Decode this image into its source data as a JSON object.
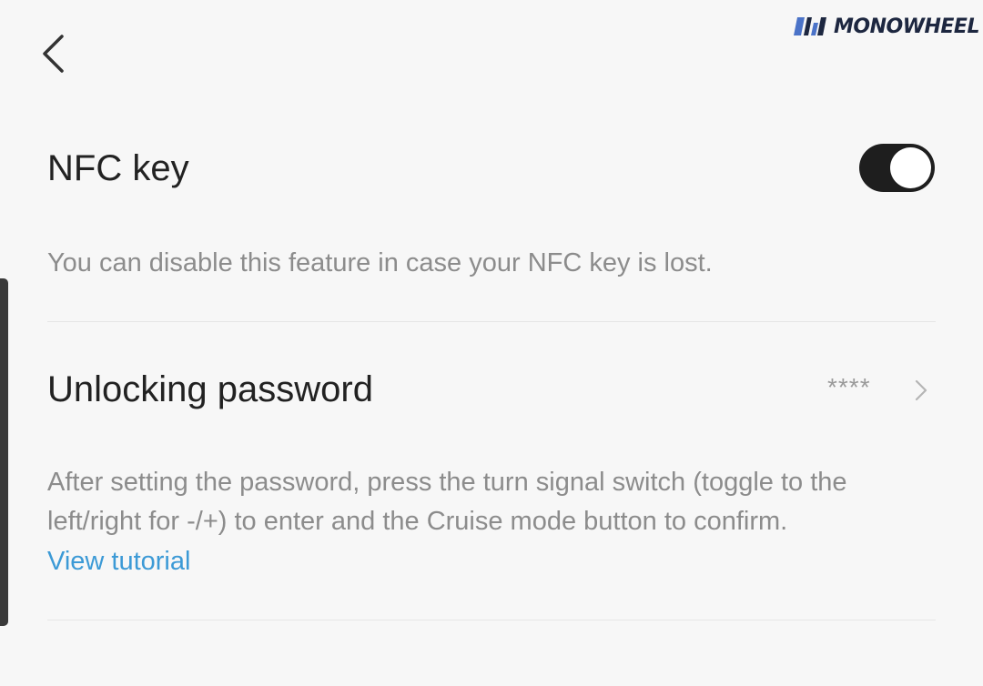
{
  "brand": {
    "logo_text": "MONOWHEEL",
    "logo_color": "#1d2740",
    "mark_color": "#4b73c8"
  },
  "nav": {
    "back_icon": "chevron-left-icon"
  },
  "nfc": {
    "title": "NFC key",
    "enabled": true,
    "description": "You can disable this feature in case your NFC key is lost."
  },
  "password": {
    "title": "Unlocking password",
    "value": "****",
    "chevron_icon": "chevron-right-icon",
    "description": "After setting the password, press the turn signal switch (toggle to the left/right for -/+) to enter and the Cruise mode button to confirm.",
    "link_label": "View tutorial"
  },
  "colors": {
    "background": "#f7f7f7",
    "toggle_on": "#1e1e1e",
    "link": "#3c9ad6"
  }
}
